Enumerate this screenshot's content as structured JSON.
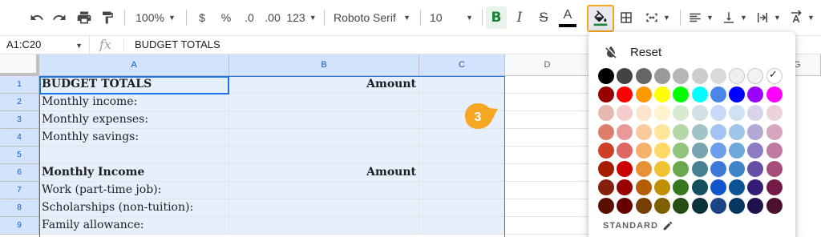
{
  "toolbar": {
    "zoom": "100%",
    "currency": "$",
    "percent": "%",
    "decrease_decimals": ".0",
    "increase_decimals": ".00",
    "number_format": "123",
    "font": "Roboto Serif",
    "font_size": "10",
    "bold": "B",
    "italic": "I",
    "strikethrough": "S",
    "text_color": "A",
    "text_color_bar": "#000000",
    "bold_active_color": "#188038",
    "fill_highlight_color": "#f5a623"
  },
  "formula_bar": {
    "cell_range": "A1:C20",
    "fx": "fx",
    "content": "BUDGET TOTALS"
  },
  "grid": {
    "columns": [
      "A",
      "B",
      "C",
      "D",
      "G"
    ],
    "rows": [
      {
        "num": "1",
        "a": "BUDGET TOTALS",
        "b": "Amount"
      },
      {
        "num": "2",
        "a": "Monthly income:",
        "b": ""
      },
      {
        "num": "3",
        "a": "Monthly expenses:",
        "b": ""
      },
      {
        "num": "4",
        "a": "Monthly savings:",
        "b": ""
      },
      {
        "num": "5",
        "a": "",
        "b": ""
      },
      {
        "num": "6",
        "a": "Monthly Income",
        "b": "Amount"
      },
      {
        "num": "7",
        "a": "Work (part-time job):",
        "b": ""
      },
      {
        "num": "8",
        "a": "Scholarships (non-tuition):",
        "b": ""
      },
      {
        "num": "9",
        "a": "Family allowance:",
        "b": ""
      }
    ]
  },
  "callout": {
    "step": "3",
    "color": "#f5a623"
  },
  "color_picker": {
    "reset_label": "Reset",
    "standard_label": "STANDARD",
    "selected_color": "#ffffff",
    "palette": [
      [
        "#000000",
        "#434343",
        "#666666",
        "#999999",
        "#b7b7b7",
        "#cccccc",
        "#d9d9d9",
        "#efefef",
        "#f3f3f3",
        "#ffffff"
      ],
      [
        "#980000",
        "#ff0000",
        "#ff9900",
        "#ffff00",
        "#00ff00",
        "#00ffff",
        "#4a86e8",
        "#0000ff",
        "#9900ff",
        "#ff00ff"
      ],
      [
        "#e6b8af",
        "#f4cccc",
        "#fce5cd",
        "#fff2cc",
        "#d9ead3",
        "#d0e0e3",
        "#c9daf8",
        "#cfe2f3",
        "#d9d2e9",
        "#ead1dc"
      ],
      [
        "#dd7e6b",
        "#ea9999",
        "#f9cb9c",
        "#ffe599",
        "#b6d7a8",
        "#a2c4c9",
        "#a4c2f4",
        "#9fc5e8",
        "#b4a7d6",
        "#d5a6bd"
      ],
      [
        "#cc4125",
        "#e06666",
        "#f6b26b",
        "#ffd966",
        "#93c47d",
        "#76a5af",
        "#6d9eeb",
        "#6fa8dc",
        "#8e7cc3",
        "#c27ba0"
      ],
      [
        "#a61c00",
        "#cc0000",
        "#e69138",
        "#f1c232",
        "#6aa84f",
        "#45818e",
        "#3c78d8",
        "#3d85c6",
        "#674ea7",
        "#a64d79"
      ],
      [
        "#85200c",
        "#990000",
        "#b45f06",
        "#bf9000",
        "#38761d",
        "#134f5c",
        "#1155cc",
        "#0b5394",
        "#351c75",
        "#741b47"
      ],
      [
        "#5b0f00",
        "#660000",
        "#783f04",
        "#7f6000",
        "#274e13",
        "#0c343d",
        "#1c4587",
        "#073763",
        "#20124d",
        "#4c1130"
      ]
    ]
  }
}
